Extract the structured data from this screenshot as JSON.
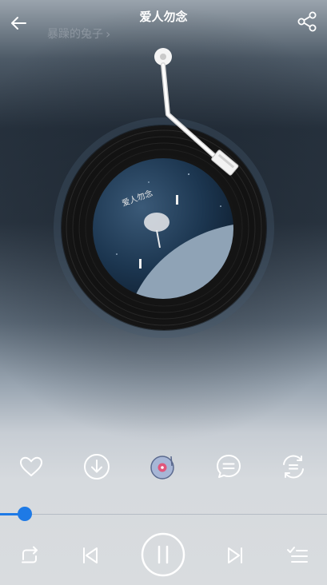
{
  "header": {
    "title": "爱人勿念",
    "artist": "暴躁的兔子",
    "artist_chevron": "›",
    "back_icon": "arrow-left",
    "share_icon": "share"
  },
  "player": {
    "state": "playing",
    "progress_fraction": 0.075,
    "accent_color": "#1e7ae6",
    "album_art_text": "爱人勿念"
  },
  "actions": [
    {
      "name": "like",
      "icon": "heart"
    },
    {
      "name": "download",
      "icon": "download-circle"
    },
    {
      "name": "record",
      "icon": "vinyl-disc"
    },
    {
      "name": "comment",
      "icon": "chat-bubble"
    },
    {
      "name": "more",
      "icon": "circle-arrows"
    }
  ],
  "controls": [
    {
      "name": "repeat",
      "icon": "repeat"
    },
    {
      "name": "previous",
      "icon": "skip-previous"
    },
    {
      "name": "pause",
      "icon": "pause"
    },
    {
      "name": "next",
      "icon": "skip-next"
    },
    {
      "name": "playlist",
      "icon": "playlist"
    }
  ]
}
